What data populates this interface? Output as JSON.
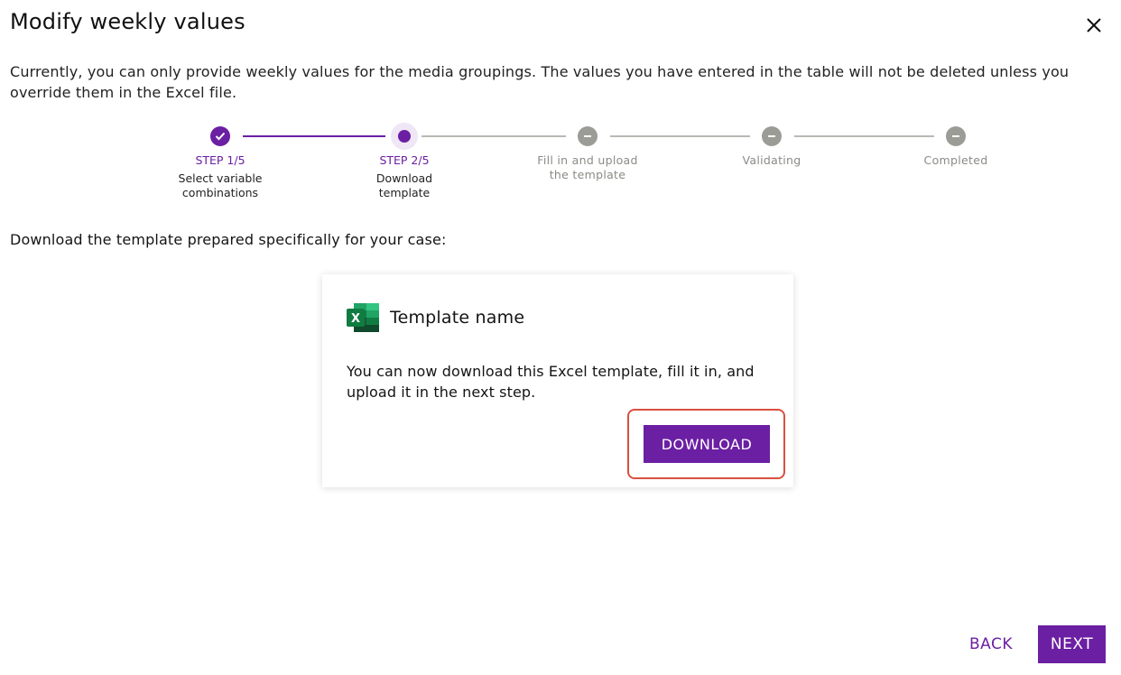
{
  "dialog": {
    "title": "Modify weekly values",
    "intro": "Currently, you can only provide weekly values for the media groupings. The values you have entered in the table will not be deleted unless you override them in the Excel file."
  },
  "stepper": {
    "steps": [
      {
        "status": "done",
        "step_label": "STEP 1/5",
        "description": "Select variable combinations"
      },
      {
        "status": "active",
        "step_label": "STEP 2/5",
        "description": "Download template"
      },
      {
        "status": "pending",
        "description": "Fill in and upload the template"
      },
      {
        "status": "pending",
        "description": "Validating"
      },
      {
        "status": "pending",
        "description": "Completed"
      }
    ]
  },
  "main": {
    "subheading": "Download the template prepared specifically for your case:",
    "card": {
      "icon": "excel-icon",
      "title": "Template name",
      "body": "You can now download this Excel template, fill it in, and upload it in the next step.",
      "download_label": "DOWNLOAD"
    }
  },
  "footer": {
    "back_label": "BACK",
    "next_label": "NEXT"
  },
  "colors": {
    "accent": "#6b1fa3",
    "pending": "#9c9c96",
    "highlight": "#d9503f"
  }
}
